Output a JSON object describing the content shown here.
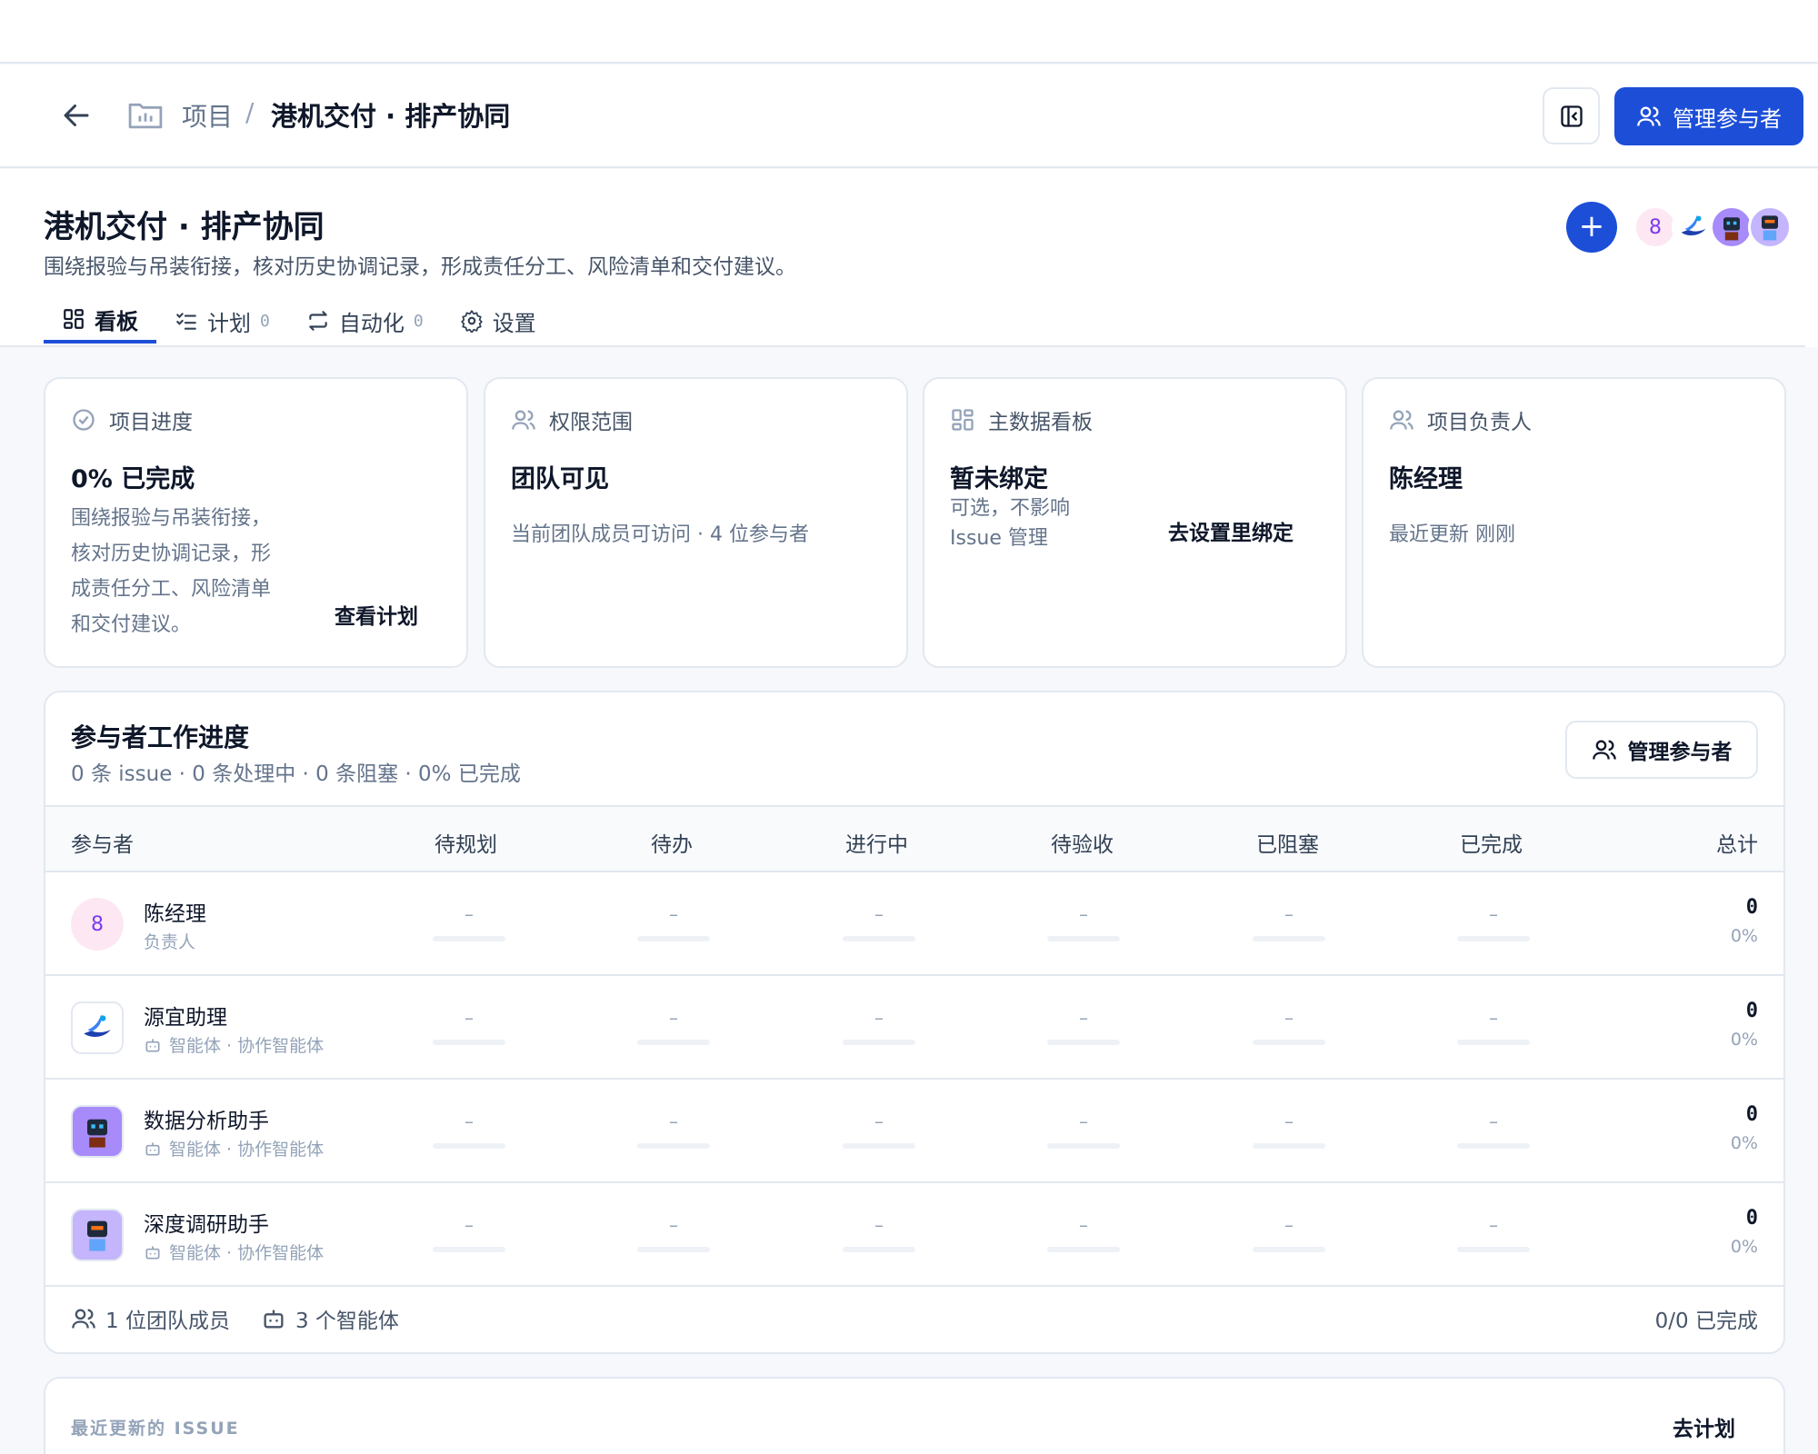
{
  "header": {
    "breadcrumb_root": "项目",
    "breadcrumb_sep": "/",
    "breadcrumb_current": "港机交付 · 排产协同",
    "manage_participants": "管理参与者"
  },
  "project": {
    "title": "港机交付 · 排产协同",
    "description": "围绕报验与吊装衔接，核对历史协调记录，形成责任分工、风险清单和交付建议。",
    "add_label": "+",
    "avatar_count": "8"
  },
  "tabs": [
    {
      "label": "看板",
      "count": ""
    },
    {
      "label": "计划",
      "count": "0"
    },
    {
      "label": "自动化",
      "count": "0"
    },
    {
      "label": "设置",
      "count": ""
    }
  ],
  "cards": {
    "progress": {
      "title": "项目进度",
      "main": "0% 已完成",
      "body_lines": [
        "围绕报验与吊装衔接，",
        "核对历史协调记录，形",
        "成责任分工、风险清单",
        "和交付建议。"
      ],
      "link": "查看计划"
    },
    "permission": {
      "title": "权限范围",
      "main": "团队可见",
      "body": "当前团队成员可访问 · 4 位参与者"
    },
    "data_board": {
      "title": "主数据看板",
      "main": "暂未绑定",
      "body_lines": [
        "可选，不影响",
        "Issue 管理"
      ],
      "link": "去设置里绑定"
    },
    "owner": {
      "title": "项目负责人",
      "main": "陈经理",
      "body": "最近更新 刚刚"
    }
  },
  "workload": {
    "title": "参与者工作进度",
    "subtitle": "0 条 issue · 0 条处理中 · 0 条阻塞 · 0% 已完成",
    "manage_button": "管理参与者",
    "columns": [
      "参与者",
      "待规划",
      "待办",
      "进行中",
      "待验收",
      "已阻塞",
      "已完成",
      "总计"
    ],
    "rows": [
      {
        "name": "陈经理",
        "role": "负责人",
        "avatar": "8",
        "cells": [
          "–",
          "–",
          "–",
          "–",
          "–",
          "–"
        ],
        "total": "0",
        "pct": "0%"
      },
      {
        "name": "源宜助理",
        "role": "智能体 · 协作智能体",
        "avatar_icon": "yuanyi-logo-icon",
        "cells": [
          "–",
          "–",
          "–",
          "–",
          "–",
          "–"
        ],
        "total": "0",
        "pct": "0%"
      },
      {
        "name": "数据分析助手",
        "role": "智能体 · 协作智能体",
        "avatar_icon": "robot-purple-icon",
        "cells": [
          "–",
          "–",
          "–",
          "–",
          "–",
          "–"
        ],
        "total": "0",
        "pct": "0%"
      },
      {
        "name": "深度调研助手",
        "role": "智能体 · 协作智能体",
        "avatar_icon": "robot-blue-icon",
        "cells": [
          "–",
          "–",
          "–",
          "–",
          "–",
          "–"
        ],
        "total": "0",
        "pct": "0%"
      }
    ],
    "footer_members": "1 位团队成员",
    "footer_agents": "3 个智能体",
    "footer_done": "0/0 已完成"
  },
  "recent": {
    "label": "最近更新的 ISSUE",
    "link": "去计划"
  },
  "colors": {
    "primary": "#1d4ed8",
    "border": "#e2e8f0",
    "muted": "#64748b"
  }
}
